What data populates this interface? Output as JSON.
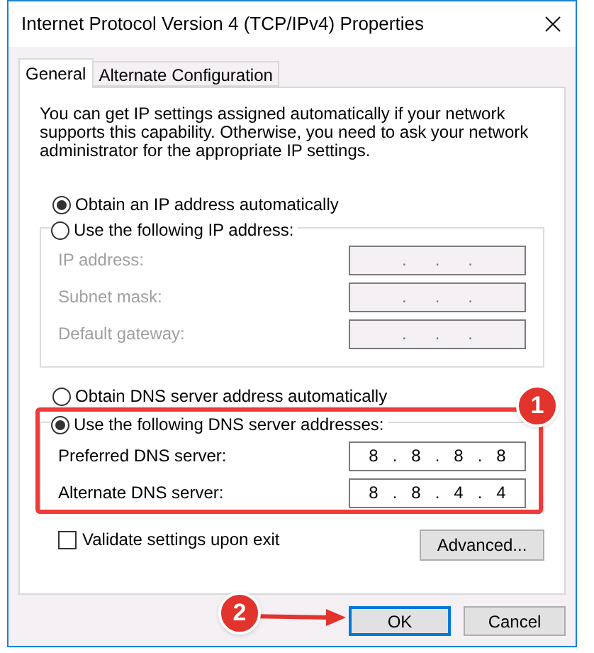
{
  "window": {
    "title": "Internet Protocol Version 4 (TCP/IPv4) Properties"
  },
  "tabs": [
    {
      "label": "General",
      "selected": true
    },
    {
      "label": "Alternate Configuration",
      "selected": false
    }
  ],
  "description": "You can get IP settings assigned automatically if your network supports this capability. Otherwise, you need to ask your network administrator for the appropriate IP settings.",
  "ip_options": [
    {
      "label": "Obtain an IP address automatically",
      "selected": true
    },
    {
      "label": "Use the following IP address:",
      "selected": false
    }
  ],
  "ip_fields": [
    {
      "label": "IP address:",
      "value": ".      .      .",
      "disabled": true
    },
    {
      "label": "Subnet mask:",
      "value": ".      .      .",
      "disabled": true
    },
    {
      "label": "Default gateway:",
      "value": ".      .      .",
      "disabled": true
    }
  ],
  "dns_options": [
    {
      "label": "Obtain DNS server address automatically",
      "selected": false
    },
    {
      "label": "Use the following DNS server addresses:",
      "selected": true
    }
  ],
  "dns_fields": [
    {
      "label": "Preferred DNS server:",
      "value": "8   .   8   .   8   .   8",
      "disabled": false
    },
    {
      "label": "Alternate DNS server:",
      "value": "8   .   8   .   4   .   4",
      "disabled": false
    }
  ],
  "validate": {
    "label": "Validate settings upon exit",
    "checked": false
  },
  "advanced_button": "Advanced...",
  "buttons": [
    {
      "label": "OK",
      "selected": true
    },
    {
      "label": "Cancel",
      "selected": false
    }
  ],
  "annotations": [
    {
      "label": "1"
    },
    {
      "label": "2"
    }
  ]
}
